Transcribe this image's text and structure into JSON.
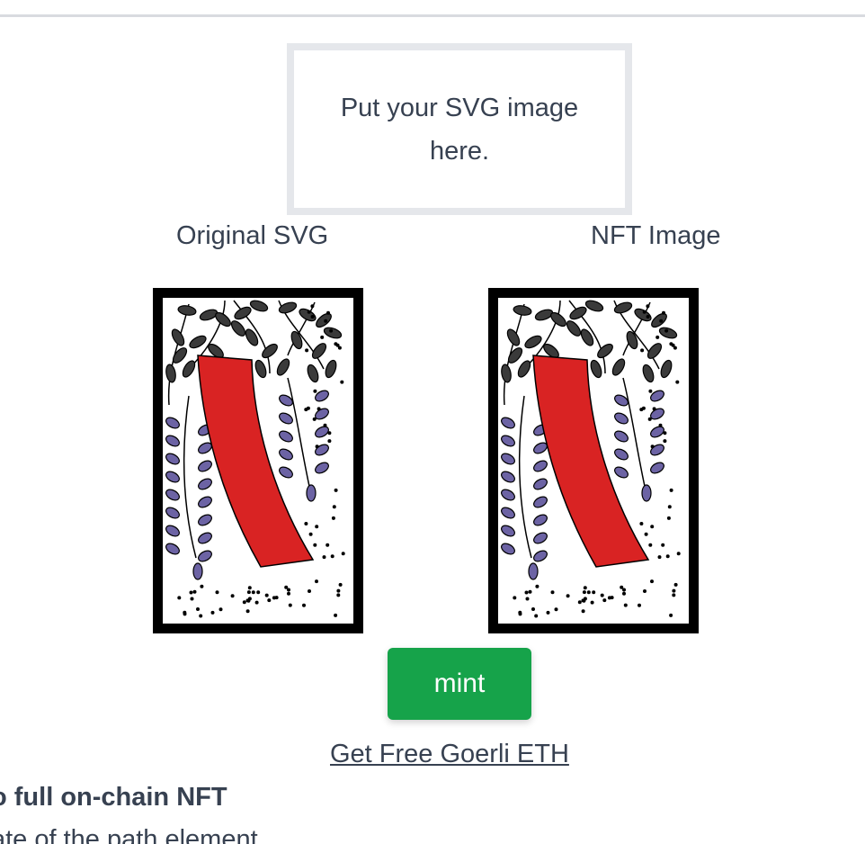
{
  "dropzone": {
    "text": "Put your SVG image here."
  },
  "labels": {
    "original": "Original SVG",
    "nft": "NFT Image"
  },
  "actions": {
    "mint": "mint",
    "faucet_link": "Get Free Goerli ETH"
  },
  "description": {
    "heading": "o full on-chain NFT",
    "line": "ate of the path element"
  },
  "colors": {
    "mint_button": "#16a34a",
    "ribbon": "#d92323",
    "leaf_dark": "#3a3a3a",
    "leaf_purple": "#6c63a4",
    "card_border": "#000000"
  }
}
